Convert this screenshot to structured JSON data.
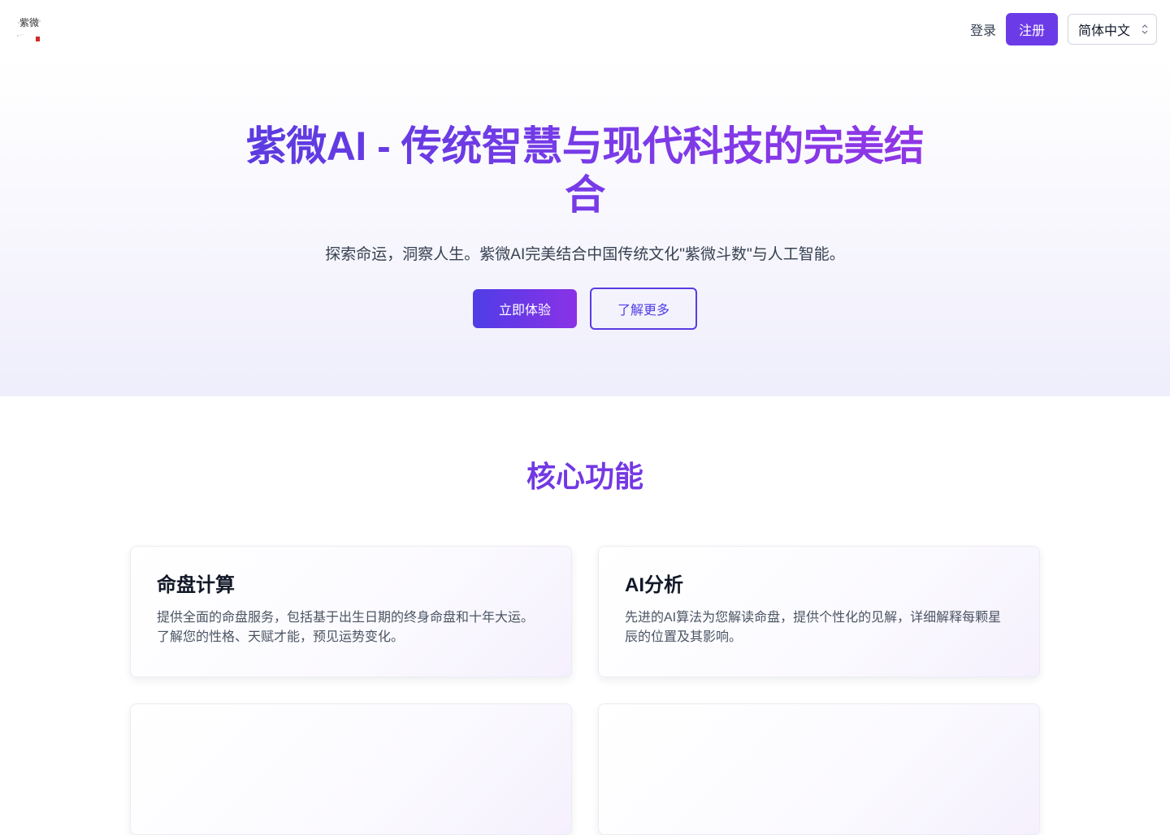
{
  "header": {
    "logo_text": "紫微",
    "login_label": "登录",
    "register_label": "注册",
    "language_selected": "简体中文"
  },
  "hero": {
    "title": "紫微AI - 传统智慧与现代科技的完美结合",
    "subtitle": "探索命运，洞察人生。紫微AI完美结合中国传统文化\"紫微斗数\"与人工智能。",
    "primary_button": "立即体验",
    "secondary_button": "了解更多"
  },
  "features": {
    "title": "核心功能",
    "cards": [
      {
        "title": "命盘计算",
        "description": "提供全面的命盘服务，包括基于出生日期的终身命盘和十年大运。了解您的性格、天赋才能，预见运势变化。"
      },
      {
        "title": "AI分析",
        "description": "先进的AI算法为您解读命盘，提供个性化的见解，详细解释每颗星辰的位置及其影响。"
      },
      {
        "title": "",
        "description": ""
      },
      {
        "title": "",
        "description": ""
      }
    ]
  },
  "colors": {
    "brand_purple": "#6c3be8",
    "gradient_start": "#4f3de6",
    "gradient_end": "#8a32e6"
  }
}
